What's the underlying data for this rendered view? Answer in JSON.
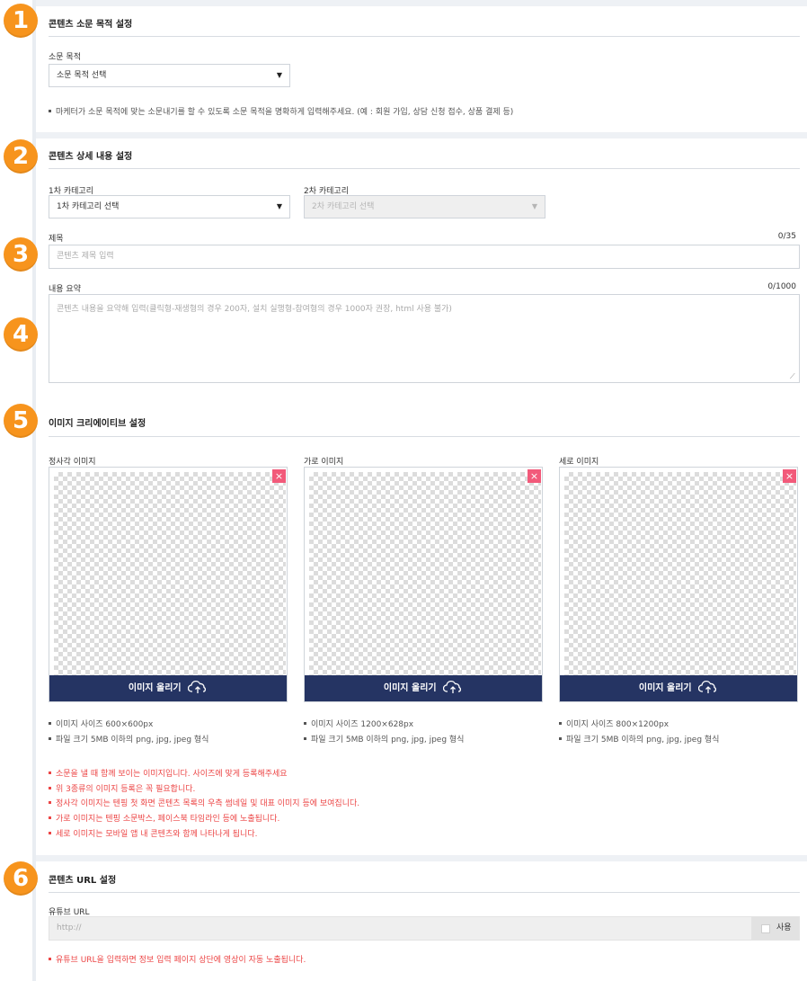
{
  "sections": {
    "purpose": {
      "badge": "1",
      "title": "콘텐츠 소문 목적 설정",
      "field_label": "소문 목적",
      "select_value": "소문 목적 선택",
      "note": "마케터가 소문 목적에 맞는 소문내기를 할 수 있도록 소문 목적을 명확하게 입력해주세요. (예 : 회원 가입, 상담 신청 접수, 상품 결제 등)"
    },
    "detail": {
      "badge": "2",
      "title": "콘텐츠 상세 내용 설정",
      "category1_label": "1차 카테고리",
      "category1_value": "1차 카테고리 선택",
      "category2_label": "2차 카테고리",
      "category2_value": "2차 카테고리 선택"
    },
    "title_field": {
      "badge": "3",
      "label": "제목",
      "counter": "0/35",
      "placeholder": "콘텐츠 제목 입력"
    },
    "summary_field": {
      "badge": "4",
      "label": "내용 요약",
      "counter": "0/1000",
      "placeholder": "콘텐츠 내용을 요약해 입력(클릭형-재생형의 경우 200자, 설치 실행형-참여형의 경우 1000자 권장, html 사용 불가)"
    },
    "images": {
      "badge": "5",
      "title": "이미지 크리에이티브 설정",
      "slots": [
        {
          "label": "정사각 이미지",
          "upload": "이미지 올리기",
          "size_note": "이미지 사이즈 600×600px",
          "file_note": "파일 크기 5MB 이하의 png, jpg, jpeg 형식"
        },
        {
          "label": "가로 이미지",
          "upload": "이미지 올리기",
          "size_note": "이미지 사이즈 1200×628px",
          "file_note": "파일 크기 5MB 이하의 png, jpg, jpeg 형식"
        },
        {
          "label": "세로 이미지",
          "upload": "이미지 올리기",
          "size_note": "이미지 사이즈 800×1200px",
          "file_note": "파일 크기 5MB 이하의 png, jpg, jpeg 형식"
        }
      ],
      "remove_symbol": "×",
      "notices": [
        "소문을 낼 때 함께 보이는 이미지입니다. 사이즈에 맞게 등록해주세요",
        "위 3종류의 이미지 등록은 꼭 필요합니다.",
        "정사각 이미지는 텐핑 첫 화면 콘텐츠 목록의 우측 썸네일 및 대표 이미지 등에 보여집니다.",
        "가로 이미지는 텐핑 소문박스, 페이스북 타임라인 등에 노출됩니다.",
        "세로 이미지는 모바일 앱 내 콘텐츠와 함께 나타나게 됩니다."
      ]
    },
    "url": {
      "badge": "6",
      "title": "콘텐츠 URL 설정",
      "field_label": "유튜브 URL",
      "placeholder": "http://",
      "use_label": "사용",
      "note": "유튜브 URL을 입력하면 정보 입력 페이지 상단에 영상이 자동 노출됩니다."
    }
  },
  "colors": {
    "badge": "#f7941d",
    "upload_button": "#253463",
    "remove_button": "#f25a7a",
    "warning_text": "#ec4545"
  }
}
